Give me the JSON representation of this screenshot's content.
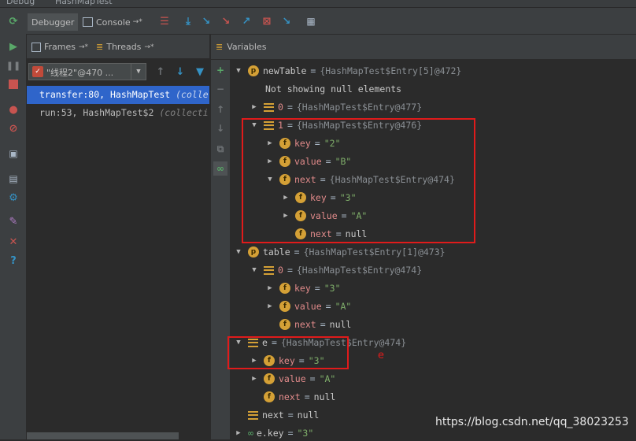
{
  "window": {
    "title_left": "Debug",
    "title_run": "HashMapTest"
  },
  "toolbar": {
    "tab_debugger": "Debugger",
    "tab_console": "Console",
    "console_suffix": "→*",
    "icons": [
      "show-execution-point-icon",
      "step-over-icon",
      "step-into-icon",
      "force-step-into-icon",
      "step-out-icon",
      "drop-frame-icon",
      "run-to-cursor-icon",
      "evaluate-icon"
    ]
  },
  "left_toolbar": [
    "rerun-icon",
    "resume-icon",
    "pause-icon",
    "stop-icon",
    "view-breakpoints-icon",
    "mute-breakpoints-icon",
    "camera-icon",
    "restore-layout-icon",
    "settings-icon",
    "pin-icon",
    "close-icon",
    "help-icon"
  ],
  "frames_panel": {
    "tab_frames": "Frames",
    "tab_threads": "Threads",
    "tab_suffix": "→*",
    "thread_selector": "\"线程2\"@470 ...",
    "frames": [
      {
        "method": "transfer:80, HashMapTest",
        "package": "(colle",
        "selected": true
      },
      {
        "method": "run:53, HashMapTest$2",
        "package": "(collecti",
        "selected": false
      }
    ]
  },
  "variables_panel": {
    "title": "Variables",
    "rows": [
      {
        "indent": 0,
        "toggle": "expanded",
        "icon": "p",
        "name": "newTable",
        "value": "{HashMapTest$Entry[5]@472}",
        "kind": "ref"
      },
      {
        "indent": 1,
        "toggle": "none",
        "icon": "none",
        "name": "",
        "value": "Not showing null elements",
        "kind": "plain"
      },
      {
        "indent": 1,
        "toggle": "collapsed",
        "icon": "array",
        "name": "0",
        "value": "{HashMapTest$Entry@477}",
        "kind": "ref"
      },
      {
        "indent": 1,
        "toggle": "expanded",
        "icon": "array",
        "name": "1",
        "value": "{HashMapTest$Entry@476}",
        "kind": "ref"
      },
      {
        "indent": 2,
        "toggle": "collapsed",
        "icon": "f",
        "name": "key",
        "value": "\"2\"",
        "kind": "str"
      },
      {
        "indent": 2,
        "toggle": "collapsed",
        "icon": "f",
        "name": "value",
        "value": "\"B\"",
        "kind": "str"
      },
      {
        "indent": 2,
        "toggle": "expanded",
        "icon": "f",
        "name": "next",
        "value": "{HashMapTest$Entry@474}",
        "kind": "ref"
      },
      {
        "indent": 3,
        "toggle": "collapsed",
        "icon": "f",
        "name": "key",
        "value": "\"3\"",
        "kind": "str"
      },
      {
        "indent": 3,
        "toggle": "collapsed",
        "icon": "f",
        "name": "value",
        "value": "\"A\"",
        "kind": "str"
      },
      {
        "indent": 3,
        "toggle": "none",
        "icon": "f",
        "name": "next",
        "value": "null",
        "kind": "null"
      },
      {
        "indent": 0,
        "toggle": "expanded",
        "icon": "p",
        "name": "table",
        "value": "{HashMapTest$Entry[1]@473}",
        "kind": "ref"
      },
      {
        "indent": 1,
        "toggle": "expanded",
        "icon": "array",
        "name": "0",
        "value": "{HashMapTest$Entry@474}",
        "kind": "ref"
      },
      {
        "indent": 2,
        "toggle": "collapsed",
        "icon": "f",
        "name": "key",
        "value": "\"3\"",
        "kind": "str"
      },
      {
        "indent": 2,
        "toggle": "collapsed",
        "icon": "f",
        "name": "value",
        "value": "\"A\"",
        "kind": "str"
      },
      {
        "indent": 2,
        "toggle": "none",
        "icon": "f",
        "name": "next",
        "value": "null",
        "kind": "null"
      },
      {
        "indent": 0,
        "toggle": "expanded",
        "icon": "array",
        "name": "e",
        "value": "{HashMapTest$Entry@474}",
        "kind": "ref"
      },
      {
        "indent": 1,
        "toggle": "collapsed",
        "icon": "f",
        "name": "key",
        "value": "\"3\"",
        "kind": "str"
      },
      {
        "indent": 1,
        "toggle": "collapsed",
        "icon": "f",
        "name": "value",
        "value": "\"A\"",
        "kind": "str"
      },
      {
        "indent": 1,
        "toggle": "none",
        "icon": "f",
        "name": "next",
        "value": "null",
        "kind": "null"
      },
      {
        "indent": 0,
        "toggle": "none",
        "icon": "array",
        "name": "next",
        "value": "null",
        "kind": "null"
      },
      {
        "indent": 0,
        "toggle": "collapsed",
        "icon": "watch",
        "name": "e.key",
        "value": "\"3\"",
        "kind": "str"
      }
    ]
  },
  "annotation": {
    "label": "e",
    "color": "#e01b1b"
  },
  "watermark": "https://blog.csdn.net/qq_38023253",
  "colors": {
    "background": "#2b2b2b",
    "panel": "#3c3f41",
    "selection": "#2f65ca",
    "field_name": "#e28b8b",
    "string_value": "#7fae6a",
    "badge": "#d4a036",
    "annotation_red": "#e01b1b"
  }
}
